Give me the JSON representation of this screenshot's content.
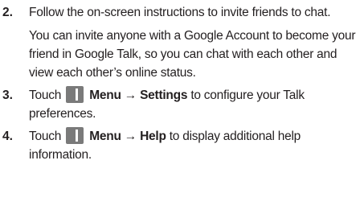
{
  "steps": [
    {
      "number": "2.",
      "text": "Follow the on-screen instructions to invite friends to chat.",
      "note": "You can invite anyone with a Google Account to become your friend in Google Talk, so you can chat with each other and view each other’s online status."
    },
    {
      "number": "3.",
      "pre": "Touch",
      "menu": "Menu",
      "arrow": "→",
      "target": "Settings",
      "post": "to configure your Talk preferences."
    },
    {
      "number": "4.",
      "pre": "Touch",
      "menu": "Menu",
      "arrow": "→",
      "target": "Help",
      "post": "to display additional help information."
    }
  ],
  "icons": {
    "menu_key": "menu-key-icon"
  }
}
